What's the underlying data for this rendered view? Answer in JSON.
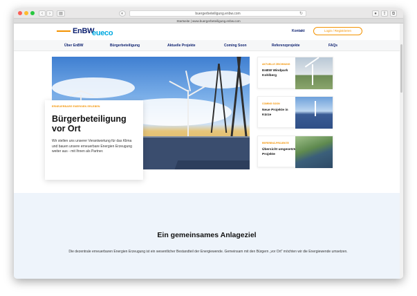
{
  "browser": {
    "url": "buergerbeteiligung.enbw.com",
    "tab_title": "Startseite | www.buergerbeteiligung.enbw.com"
  },
  "header": {
    "logo_enbw": "EnBW",
    "logo_eueco": "eueco",
    "contact": "Kontakt",
    "login": "Login / Registrieren"
  },
  "nav": {
    "items": [
      "Über EnBW",
      "Bürgerbeteiligung",
      "Aktuelle Projekte",
      "Coming Soon",
      "Referenzprojekte",
      "FAQs"
    ]
  },
  "hero": {
    "kicker": "ERNEUERBARE ENERGIEN ERLEBEN",
    "title_line1": "Bürgerbeteiligung",
    "title_line2": "vor Ort",
    "text": "Wir stellen uns unserer Verantwortung für das Klima und bauen unsere erneuerbare Energien Erzeugung weiter aus - mit Ihnen als Partner."
  },
  "tiles": [
    {
      "kicker": "AKTUELLE ZEICHNUNG",
      "title": "EnBW Windpark Kohlberg"
    },
    {
      "kicker": "COMING SOON",
      "title": "Neue Projekte in Kürze"
    },
    {
      "kicker": "REFERENZ-PROJEKTE",
      "title": "Übersicht umgesetzte Projekte"
    }
  ],
  "section": {
    "title": "Ein gemeinsames Anlageziel",
    "text": "Die dezentrale erneuerbaren Energien Erzeugung ist ein wesentlicher Bestandteil der Energiewende. Gemeinsam mit den Bürgern „vor Ort“ möchten wir die Energiewende umsetzen."
  },
  "colors": {
    "accent": "#f39200",
    "brand": "#0a1e6e",
    "section_bg": "#eef4fb"
  }
}
